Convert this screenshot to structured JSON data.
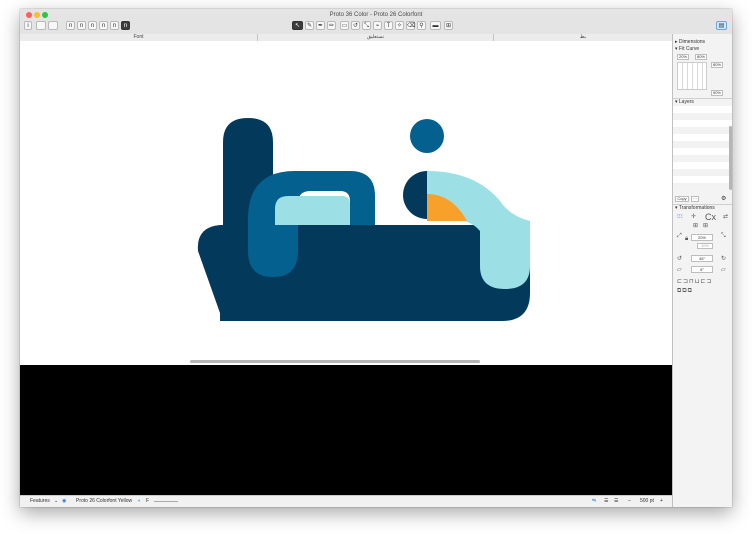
{
  "window": {
    "title": "Proto 36 Color - Proto 26 Colorfont",
    "controls": {
      "close": "#ff5f57",
      "minimize": "#febc2e",
      "zoom": "#28c840"
    }
  },
  "toolbar": {
    "glyph_buttons": [
      "n",
      "n",
      "n",
      "n",
      "n",
      "n"
    ],
    "tools": [
      "select-arrow-icon",
      "pen-icon",
      "draw-icon",
      "pencil-icon",
      "rectangle-icon",
      "rotate-icon",
      "scale-icon",
      "knife-icon",
      "text-icon",
      "annotation-icon",
      "eraser-icon",
      "zoom-icon",
      "measure-icon",
      "shopping-cart-icon"
    ]
  },
  "tabs": [
    "Font",
    "ﻧﺴﺘﻌﻠﻴﻖ",
    "ﺑﻂ"
  ],
  "statusbar": {
    "features_label": "Features",
    "layer_name": "Proto 26 Colorfont Yellow",
    "variation_letter": "F",
    "zoom": "500 pt"
  },
  "panel": {
    "dimensions_label": "Dimensions",
    "fit_curve_label": "Fit Curve",
    "fit_curve_values": [
      "20%",
      "80%",
      "80%",
      "90%"
    ],
    "layers_label": "Layers",
    "layer_copy_label": "Copy",
    "transformations_label": "Transformations",
    "scale_value": "20%",
    "scale_value_2": "10%",
    "rotate_value": "45°",
    "slant_value": "5°"
  },
  "colors": {
    "navy": "#033a5c",
    "blue": "#03608f",
    "teal": "#9ce0e6",
    "orange": "#f7a12a",
    "preview_bg": "#000000"
  }
}
